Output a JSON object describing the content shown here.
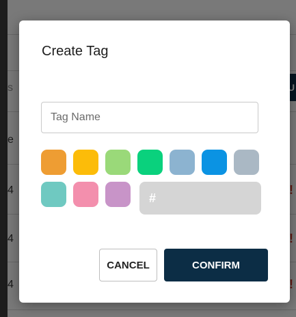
{
  "background": {
    "row_fragments": [
      "e",
      "4",
      "4",
      "4"
    ],
    "header_fragment": "s",
    "right_button_fragment": "U"
  },
  "dialog": {
    "title": "Create Tag",
    "tag_name": {
      "value": "",
      "placeholder": "Tag Name"
    },
    "colors": {
      "swatches": [
        {
          "name": "orange",
          "hex": "#ee9d33"
        },
        {
          "name": "yellow",
          "hex": "#fcbc09"
        },
        {
          "name": "light-green",
          "hex": "#9ad979"
        },
        {
          "name": "green",
          "hex": "#0ad17d"
        },
        {
          "name": "steel-blue",
          "hex": "#8cb3d0"
        },
        {
          "name": "blue",
          "hex": "#0b93e3"
        },
        {
          "name": "gray-blue",
          "hex": "#aab8c4"
        },
        {
          "name": "teal",
          "hex": "#6fc9c1"
        },
        {
          "name": "pink",
          "hex": "#f38fad"
        },
        {
          "name": "lavender",
          "hex": "#c894c8"
        }
      ],
      "hex_symbol": "#"
    },
    "cancel_label": "CANCEL",
    "confirm_label": "CONFIRM"
  }
}
